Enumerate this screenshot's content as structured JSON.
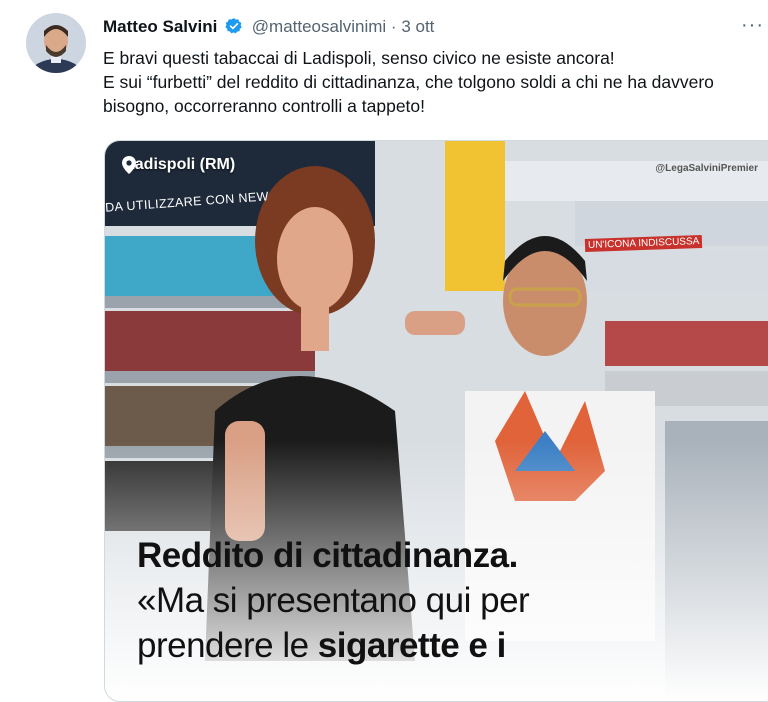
{
  "tweet": {
    "author_name": "Matteo Salvini",
    "handle": "@matteosalvinimi",
    "separator": "·",
    "time": "3 ott",
    "more_icon": "more-horizontal-icon",
    "verified_icon": "verified-badge-icon",
    "text_line1": "E bravi questi tabaccai di Ladispoli, senso civico ne esiste ancora!",
    "text_line2": "E sui “furbetti” del reddito di cittadinanza, che tolgono soldi a chi ne ha davvero bisogno, occorreranno controlli a tappeto!"
  },
  "media": {
    "location": "Ladispoli (RM)",
    "sign_text": "DA UTILIZZARE CON NEW",
    "sign2_text": "UN'ICONA INDISCUSSA",
    "watermark": "@LegaSalviniPremier",
    "headline_line1": "Reddito di cittadinanza.",
    "headline_line2": "«Ma si presentano qui per",
    "headline_line3_a": "prendere le ",
    "headline_line3_b": "sigarette e i"
  },
  "colors": {
    "verified": "#1d9bf0",
    "text": "#0f1419",
    "secondary": "#536471"
  }
}
